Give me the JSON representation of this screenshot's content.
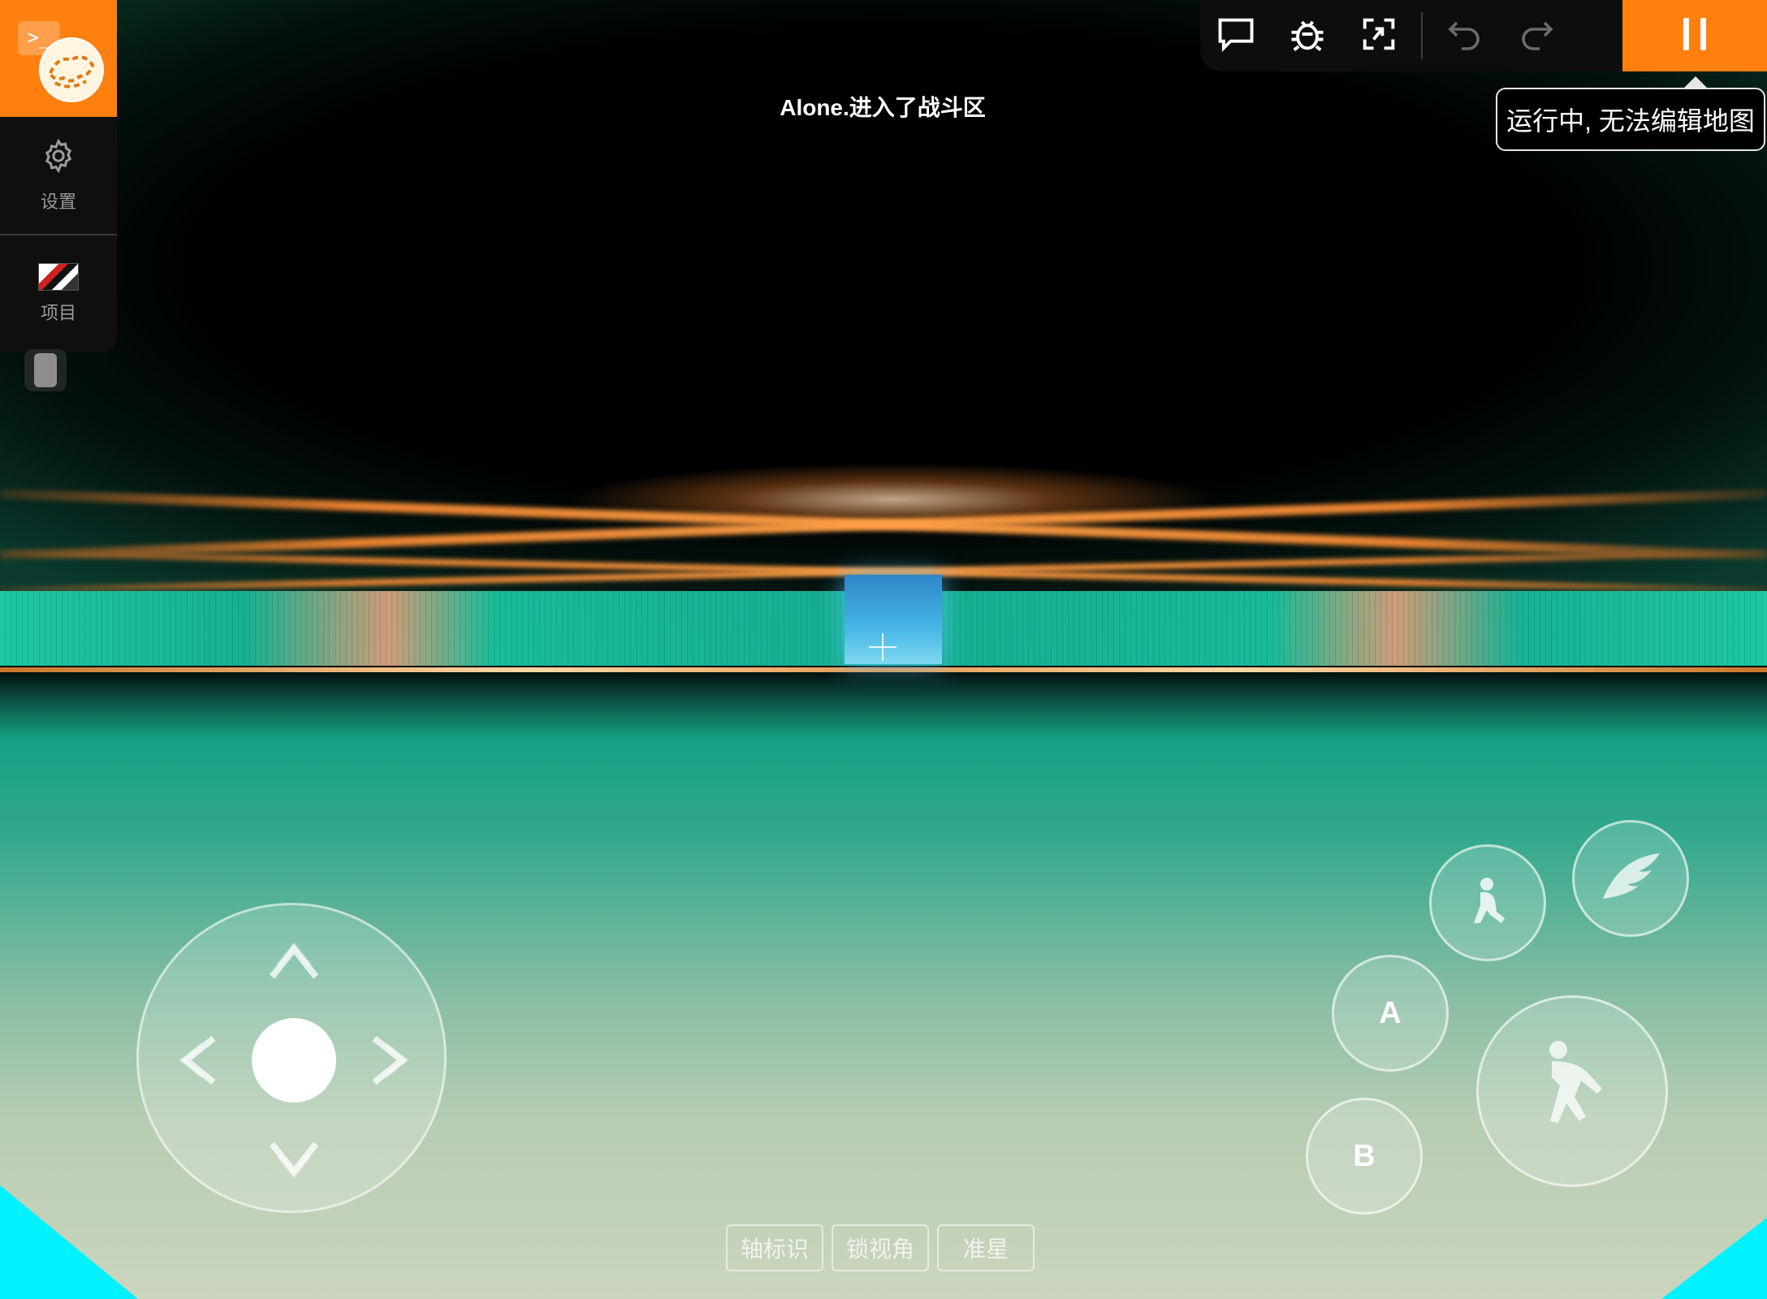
{
  "sidebar": {
    "terminal_glyph": ">_",
    "items": [
      {
        "label": "设置",
        "icon": "gear-icon"
      },
      {
        "label": "项目",
        "icon": "project-thumbnail"
      }
    ]
  },
  "toolbar": {
    "icons": [
      "chat-icon",
      "bug-icon",
      "collapse-icon",
      "undo-icon",
      "redo-icon",
      "pause-icon"
    ],
    "accent": "#ff7f0f"
  },
  "tooltip": {
    "text": "运行中, 无法编辑地图"
  },
  "toast": {
    "text": "Alone.进入了战斗区"
  },
  "controls": {
    "a_label": "A",
    "b_label": "B",
    "icons": [
      "crouch-icon",
      "fly-wing-icon",
      "sprint-runner-icon"
    ]
  },
  "bottom_chips": [
    "轴标识",
    "锁视角",
    "准星"
  ]
}
